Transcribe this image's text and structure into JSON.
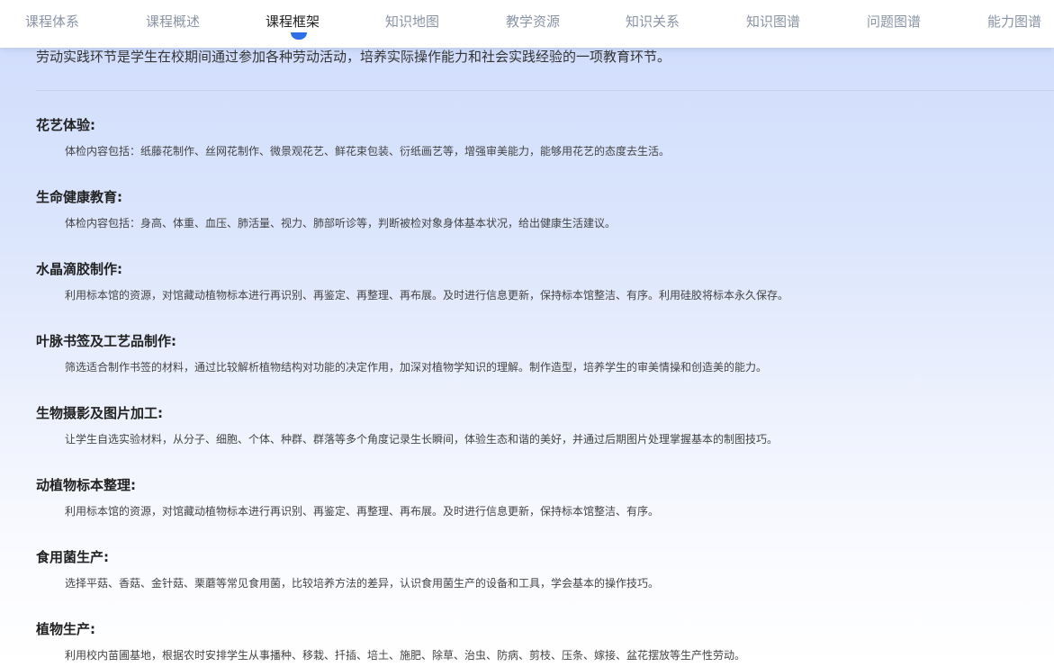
{
  "nav": {
    "tabs": [
      {
        "label": "课程体系"
      },
      {
        "label": "课程概述"
      },
      {
        "label": "课程框架"
      },
      {
        "label": "知识地图"
      },
      {
        "label": "教学资源"
      },
      {
        "label": "知识关系"
      },
      {
        "label": "知识图谱"
      },
      {
        "label": "问题图谱"
      },
      {
        "label": "能力图谱"
      }
    ],
    "active_index": 2,
    "accent_color": "#2f6fe5"
  },
  "intro": "劳动实践环节是学生在校期间通过参加各种劳动活动，培养实际操作能力和社会实践经验的一项教育环节。",
  "sections": [
    {
      "title": "花艺体验:",
      "desc": "体检内容包括：纸藤花制作、丝网花制作、微景观花艺、鲜花束包装、衍纸画艺等，增强审美能力，能够用花艺的态度去生活。"
    },
    {
      "title": "生命健康教育:",
      "desc": "体检内容包括：身高、体重、血压、肺活量、视力、肺部听诊等，判断被检对象身体基本状况，给出健康生活建议。"
    },
    {
      "title": "水晶滴胶制作:",
      "desc": "利用标本馆的资源，对馆藏动植物标本进行再识别、再鉴定、再整理、再布展。及时进行信息更新，保持标本馆整洁、有序。利用硅胶将标本永久保存。"
    },
    {
      "title": "叶脉书签及工艺品制作:",
      "desc": "筛选适合制作书签的材料，通过比较解析植物结构对功能的决定作用，加深对植物学知识的理解。制作造型，培养学生的审美情操和创造美的能力。"
    },
    {
      "title": "生物摄影及图片加工:",
      "desc": "让学生自选实验材料，从分子、细胞、个体、种群、群落等多个角度记录生长瞬间，体验生态和谐的美好，并通过后期图片处理掌握基本的制图技巧。"
    },
    {
      "title": "动植物标本整理:",
      "desc": "利用标本馆的资源，对馆藏动植物标本进行再识别、再鉴定、再整理、再布展。及时进行信息更新，保持标本馆整洁、有序。"
    },
    {
      "title": "食用菌生产:",
      "desc": "选择平菇、香菇、金针菇、栗蘑等常见食用菌，比较培养方法的差异，认识食用菌生产的设备和工具，学会基本的操作技巧。"
    },
    {
      "title": "植物生产:",
      "desc": "利用校内苗圃基地，根据农时安排学生从事播种、移栽、扦插、培土、施肥、除草、治虫、防病、剪枝、压条、嫁接、盆花摆放等生产性劳动。"
    }
  ]
}
